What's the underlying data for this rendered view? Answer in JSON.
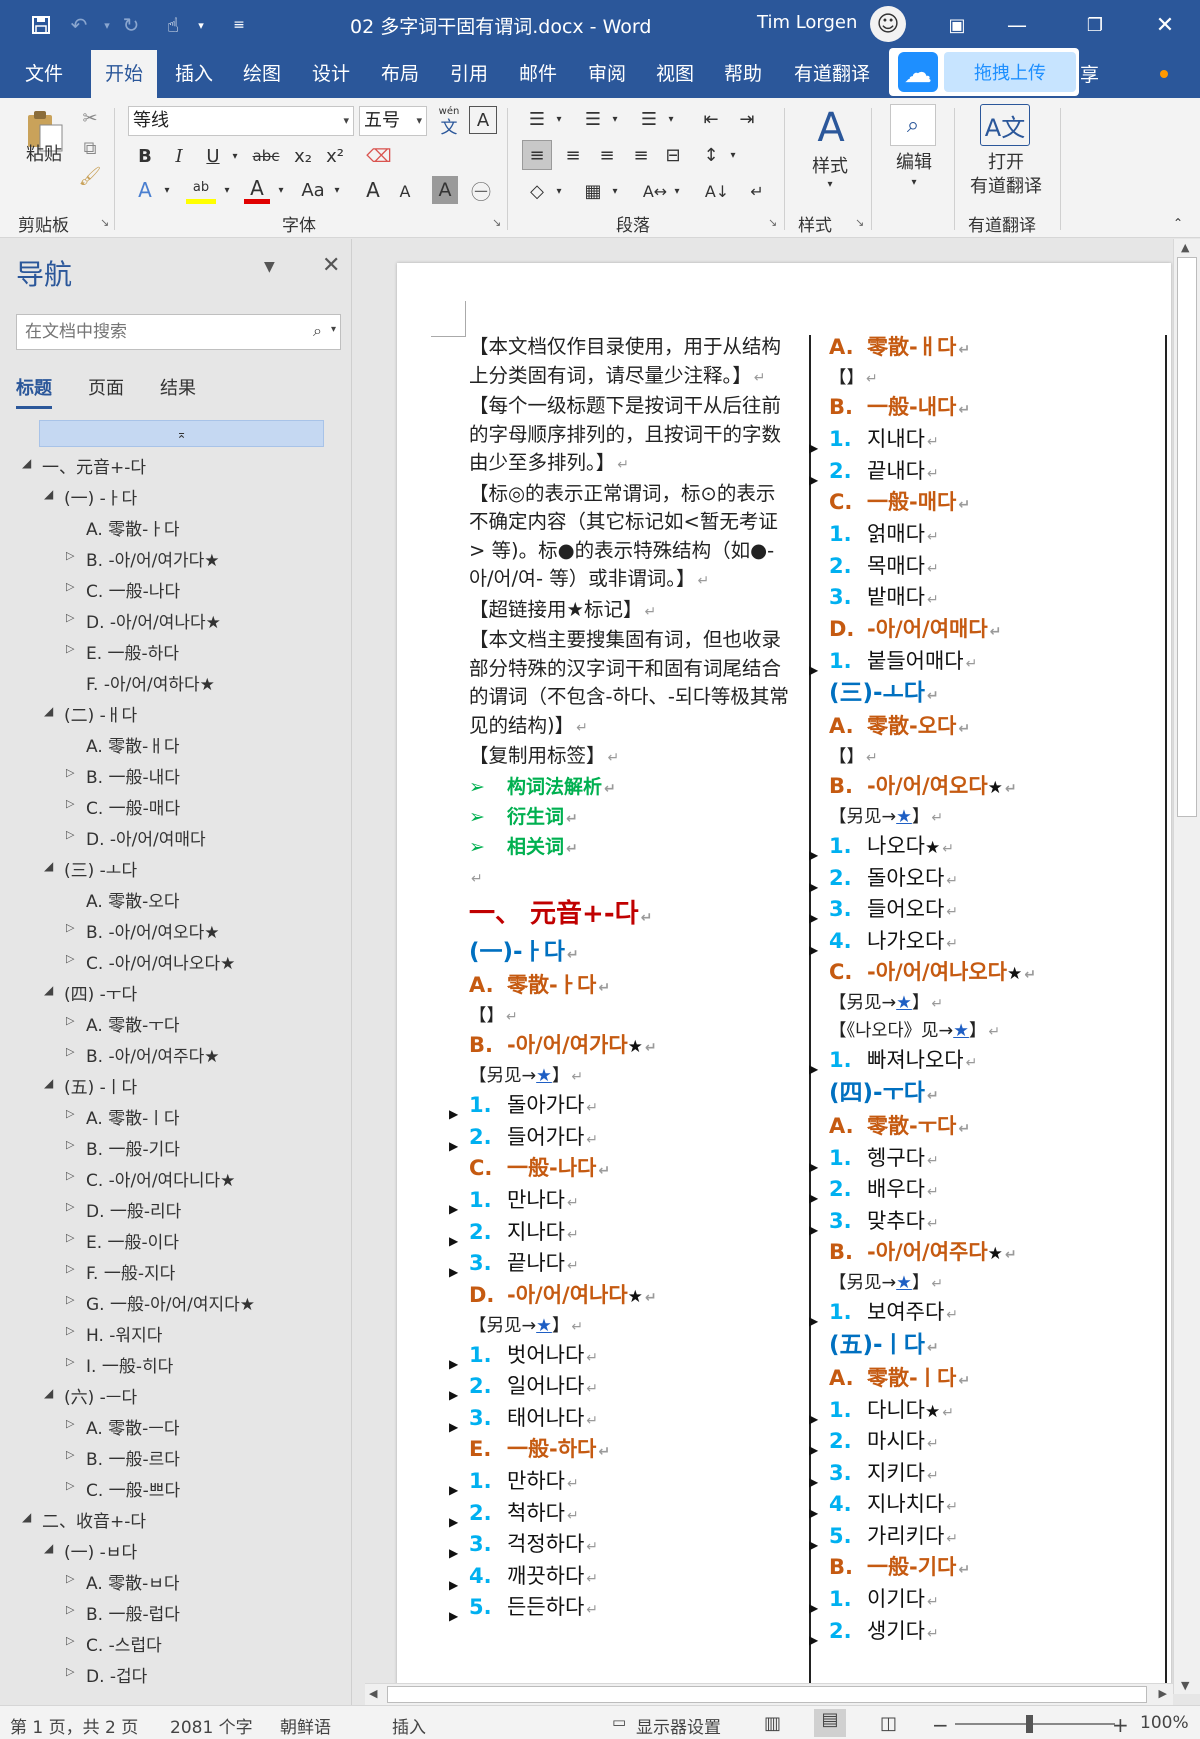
{
  "titlebar": {
    "doc_title": "02 多字词干固有谓词.docx  -  Word",
    "user_name": "Tim Lorgen",
    "save_icon": "save-icon",
    "undo_icon": "undo-icon",
    "redo_icon": "redo-icon",
    "touch_icon": "touch-mode-icon",
    "customize_icon": "customize-qat-icon"
  },
  "menu": {
    "tabs": [
      "文件",
      "开始",
      "插入",
      "绘图",
      "设计",
      "布局",
      "引用",
      "邮件",
      "审阅",
      "视图",
      "帮助",
      "有道翻译"
    ],
    "active_tab": "开始",
    "upload_label": "拖拽上传",
    "share_label": "享"
  },
  "ribbon": {
    "paste_label": "粘贴",
    "clipboard_label": "剪贴板",
    "font_name": "等线",
    "font_size": "五号",
    "pinyin_label": "wén",
    "pinyin_char": "文",
    "bold": "B",
    "italic": "I",
    "underline": "U",
    "strike": "abc",
    "subscript": "x₂",
    "superscript": "x²",
    "change_case": "Aa",
    "grow_font": "A",
    "shrink_font": "A",
    "font_group_label": "字体",
    "paragraph_group_label": "段落",
    "styles_label": "样式",
    "styles_group_label": "样式",
    "edit_label": "编辑",
    "translate_label_1": "打开",
    "translate_label_2": "有道翻译",
    "translate_group_label": "有道翻译",
    "accent_color": "#2b579a"
  },
  "nav": {
    "title": "导航",
    "search_placeholder": "在文档中搜索",
    "tabs": [
      "标题",
      "页面",
      "结果"
    ],
    "items": [
      {
        "label": "一、元音+-다",
        "level": 0,
        "state": "expanded"
      },
      {
        "label": "(一) -ㅏ다",
        "level": 1,
        "state": "expanded"
      },
      {
        "label": "A. 零散-ㅏ다",
        "level": 2,
        "state": "none"
      },
      {
        "label": "B. -아/어/여가다★",
        "level": 2,
        "state": "collapsed"
      },
      {
        "label": "C. 一般-나다",
        "level": 2,
        "state": "collapsed"
      },
      {
        "label": "D. -아/어/여나다★",
        "level": 2,
        "state": "collapsed"
      },
      {
        "label": "E. 一般-하다",
        "level": 2,
        "state": "collapsed"
      },
      {
        "label": "F. -아/어/여하다★",
        "level": 2,
        "state": "none"
      },
      {
        "label": "(二) -ㅐ다",
        "level": 1,
        "state": "expanded"
      },
      {
        "label": "A. 零散-ㅐ다",
        "level": 2,
        "state": "none"
      },
      {
        "label": "B. 一般-내다",
        "level": 2,
        "state": "collapsed"
      },
      {
        "label": "C. 一般-매다",
        "level": 2,
        "state": "collapsed"
      },
      {
        "label": "D. -아/어/여매다",
        "level": 2,
        "state": "collapsed"
      },
      {
        "label": "(三) -ㅗ다",
        "level": 1,
        "state": "expanded"
      },
      {
        "label": "A. 零散-오다",
        "level": 2,
        "state": "none"
      },
      {
        "label": "B. -아/어/여오다★",
        "level": 2,
        "state": "collapsed"
      },
      {
        "label": "C. -아/어/여나오다★",
        "level": 2,
        "state": "collapsed"
      },
      {
        "label": "(四) -ㅜ다",
        "level": 1,
        "state": "expanded"
      },
      {
        "label": "A. 零散-ㅜ다",
        "level": 2,
        "state": "collapsed"
      },
      {
        "label": "B. -아/어/여주다★",
        "level": 2,
        "state": "collapsed"
      },
      {
        "label": "(五) -ㅣ다",
        "level": 1,
        "state": "expanded"
      },
      {
        "label": "A. 零散-ㅣ다",
        "level": 2,
        "state": "collapsed"
      },
      {
        "label": "B. 一般-기다",
        "level": 2,
        "state": "collapsed"
      },
      {
        "label": "C. -아/어/여다니다★",
        "level": 2,
        "state": "collapsed"
      },
      {
        "label": "D. 一般-리다",
        "level": 2,
        "state": "collapsed"
      },
      {
        "label": "E. 一般-이다",
        "level": 2,
        "state": "collapsed"
      },
      {
        "label": "F. 一般-지다",
        "level": 2,
        "state": "collapsed"
      },
      {
        "label": "G. 一般-아/어/여지다★",
        "level": 2,
        "state": "collapsed"
      },
      {
        "label": "H. -워지다",
        "level": 2,
        "state": "collapsed"
      },
      {
        "label": "I. 一般-히다",
        "level": 2,
        "state": "collapsed"
      },
      {
        "label": "(六) -ㅡ다",
        "level": 1,
        "state": "expanded"
      },
      {
        "label": "A. 零散-ㅡ다",
        "level": 2,
        "state": "collapsed"
      },
      {
        "label": "B. 一般-르다",
        "level": 2,
        "state": "collapsed"
      },
      {
        "label": "C. 一般-쁘다",
        "level": 2,
        "state": "collapsed"
      },
      {
        "label": "二、收音+-다",
        "level": 0,
        "state": "expanded"
      },
      {
        "label": "(一) -ㅂ다",
        "level": 1,
        "state": "expanded"
      },
      {
        "label": "A. 零散-ㅂ다",
        "level": 2,
        "state": "collapsed"
      },
      {
        "label": "B. 一般-럽다",
        "level": 2,
        "state": "collapsed"
      },
      {
        "label": "C. -스럽다",
        "level": 2,
        "state": "collapsed"
      },
      {
        "label": "D. -겁다",
        "level": 2,
        "state": "collapsed"
      }
    ]
  },
  "document": {
    "left_column": [
      {
        "type": "para",
        "text": "【本文档仅作目录使用，用于从结构上分类固有词，请尽量少注释。】"
      },
      {
        "type": "para",
        "text": "【每个一级标题下是按词干从后往前的字母顺序排列的，且按词干的字数由少至多排列。】"
      },
      {
        "type": "para",
        "text": "【标◎的表示正常谓词，标⊙的表示不确定内容（其它标记如<暂无考证> 等)。标●的表示特殊结构（如●-아/어/여- 等）或非谓词。】"
      },
      {
        "type": "para",
        "text": "【超链接用★标记】"
      },
      {
        "type": "para",
        "text": "【本文档主要搜集固有词，但也收录部分特殊的汉字词干和固有词尾结合的谓词（不包含-하다、-되다等极其常见的结构)】"
      },
      {
        "type": "para",
        "text": "【复制用标签】"
      },
      {
        "type": "green",
        "text": "构词法解析"
      },
      {
        "type": "green",
        "text": "衍生词"
      },
      {
        "type": "green",
        "text": "相关词"
      },
      {
        "type": "blank",
        "text": ""
      },
      {
        "type": "h1",
        "text": "一、 元音+-다"
      },
      {
        "type": "h2",
        "text": "(一)-ㅏ다"
      },
      {
        "type": "h3",
        "num": "A.",
        "text": "零散-ㅏ다"
      },
      {
        "type": "note",
        "text": "【】"
      },
      {
        "type": "h3",
        "num": "B.",
        "text": "-아/어/여가다",
        "star": "★"
      },
      {
        "type": "note",
        "text": "【另见→",
        "link": "★",
        "tail": "】"
      },
      {
        "type": "item",
        "num": "1.",
        "text": "돌아가다",
        "arrow": true
      },
      {
        "type": "item",
        "num": "2.",
        "text": "들어가다",
        "arrow": true
      },
      {
        "type": "h3",
        "num": "C.",
        "text": "一般-나다"
      },
      {
        "type": "item",
        "num": "1.",
        "text": "만나다",
        "arrow": true
      },
      {
        "type": "item",
        "num": "2.",
        "text": "지나다",
        "arrow": true
      },
      {
        "type": "item",
        "num": "3.",
        "text": "끝나다",
        "arrow": true
      },
      {
        "type": "h3",
        "num": "D.",
        "text": "-아/어/여나다",
        "star": "★"
      },
      {
        "type": "note",
        "text": "【另见→",
        "link": "★",
        "tail": "】"
      },
      {
        "type": "item",
        "num": "1.",
        "text": "벗어나다",
        "arrow": true
      },
      {
        "type": "item",
        "num": "2.",
        "text": "일어나다",
        "arrow": true
      },
      {
        "type": "item",
        "num": "3.",
        "text": "태어나다",
        "arrow": true
      },
      {
        "type": "h3",
        "num": "E.",
        "text": "一般-하다"
      },
      {
        "type": "item",
        "num": "1.",
        "text": "만하다",
        "arrow": true
      },
      {
        "type": "item",
        "num": "2.",
        "text": "척하다",
        "arrow": true
      },
      {
        "type": "item",
        "num": "3.",
        "text": "걱정하다",
        "arrow": true
      },
      {
        "type": "item",
        "num": "4.",
        "text": "깨끗하다",
        "arrow": true
      },
      {
        "type": "item",
        "num": "5.",
        "text": "든든하다",
        "arrow": true
      }
    ],
    "right_column": [
      {
        "type": "h3",
        "num": "A.",
        "text": "零散-ㅐ다"
      },
      {
        "type": "note",
        "text": "【】"
      },
      {
        "type": "h3",
        "num": "B.",
        "text": "一般-내다"
      },
      {
        "type": "item",
        "num": "1.",
        "text": "지내다",
        "arrow": true
      },
      {
        "type": "item",
        "num": "2.",
        "text": "끝내다",
        "arrow": true
      },
      {
        "type": "h3",
        "num": "C.",
        "text": "一般-매다"
      },
      {
        "type": "item",
        "num": "1.",
        "text": "얽매다",
        "arrow": false
      },
      {
        "type": "item",
        "num": "2.",
        "text": "목매다",
        "arrow": false
      },
      {
        "type": "item",
        "num": "3.",
        "text": "밭매다",
        "arrow": false
      },
      {
        "type": "h3",
        "num": "D.",
        "text": "-아/어/여매다"
      },
      {
        "type": "item",
        "num": "1.",
        "text": "붙들어매다",
        "arrow": true
      },
      {
        "type": "h2",
        "text": "(三)-ㅗ다"
      },
      {
        "type": "h3",
        "num": "A.",
        "text": "零散-오다"
      },
      {
        "type": "note",
        "text": "【】"
      },
      {
        "type": "h3",
        "num": "B.",
        "text": "-아/어/여오다",
        "star": "★"
      },
      {
        "type": "note",
        "text": "【另见→",
        "link": "★",
        "tail": "】"
      },
      {
        "type": "item",
        "num": "1.",
        "text": "나오다",
        "arrow": true,
        "star": "★"
      },
      {
        "type": "item",
        "num": "2.",
        "text": "돌아오다",
        "arrow": true
      },
      {
        "type": "item",
        "num": "3.",
        "text": "들어오다",
        "arrow": true
      },
      {
        "type": "item",
        "num": "4.",
        "text": "나가오다",
        "arrow": true
      },
      {
        "type": "h3",
        "num": "C.",
        "text": "-아/어/여나오다",
        "star": "★"
      },
      {
        "type": "note",
        "text": "【另见→",
        "link": "★",
        "tail": "】"
      },
      {
        "type": "note",
        "text": "【《나오다》见→",
        "link": "★",
        "tail": "】"
      },
      {
        "type": "item",
        "num": "1.",
        "text": "빠져나오다",
        "arrow": true
      },
      {
        "type": "h2",
        "text": "(四)-ㅜ다"
      },
      {
        "type": "h3",
        "num": "A.",
        "text": "零散-ㅜ다"
      },
      {
        "type": "item",
        "num": "1.",
        "text": "헹구다",
        "arrow": true
      },
      {
        "type": "item",
        "num": "2.",
        "text": "배우다",
        "arrow": true
      },
      {
        "type": "item",
        "num": "3.",
        "text": "맞추다",
        "arrow": true
      },
      {
        "type": "h3",
        "num": "B.",
        "text": "-아/어/여주다",
        "star": "★"
      },
      {
        "type": "note",
        "text": "【另见→",
        "link": "★",
        "tail": "】"
      },
      {
        "type": "item",
        "num": "1.",
        "text": "보여주다",
        "arrow": true
      },
      {
        "type": "h2",
        "text": "(五)-ㅣ다"
      },
      {
        "type": "h3",
        "num": "A.",
        "text": "零散-ㅣ다"
      },
      {
        "type": "item",
        "num": "1.",
        "text": "다니다",
        "arrow": true,
        "star": "★"
      },
      {
        "type": "item",
        "num": "2.",
        "text": "마시다",
        "arrow": true
      },
      {
        "type": "item",
        "num": "3.",
        "text": "지키다",
        "arrow": true
      },
      {
        "type": "item",
        "num": "4.",
        "text": "지나치다",
        "arrow": true
      },
      {
        "type": "item",
        "num": "5.",
        "text": "가리키다",
        "arrow": true
      },
      {
        "type": "h3",
        "num": "B.",
        "text": "一般-기다"
      },
      {
        "type": "item",
        "num": "1.",
        "text": "이기다",
        "arrow": true
      },
      {
        "type": "item",
        "num": "2.",
        "text": "생기다",
        "arrow": true
      }
    ]
  },
  "status": {
    "page": "第 1 页，共 2 页",
    "words": "2081 个字",
    "language": "朝鲜语",
    "mode": "插入",
    "display_settings": "显示器设置",
    "zoom": "100%"
  }
}
